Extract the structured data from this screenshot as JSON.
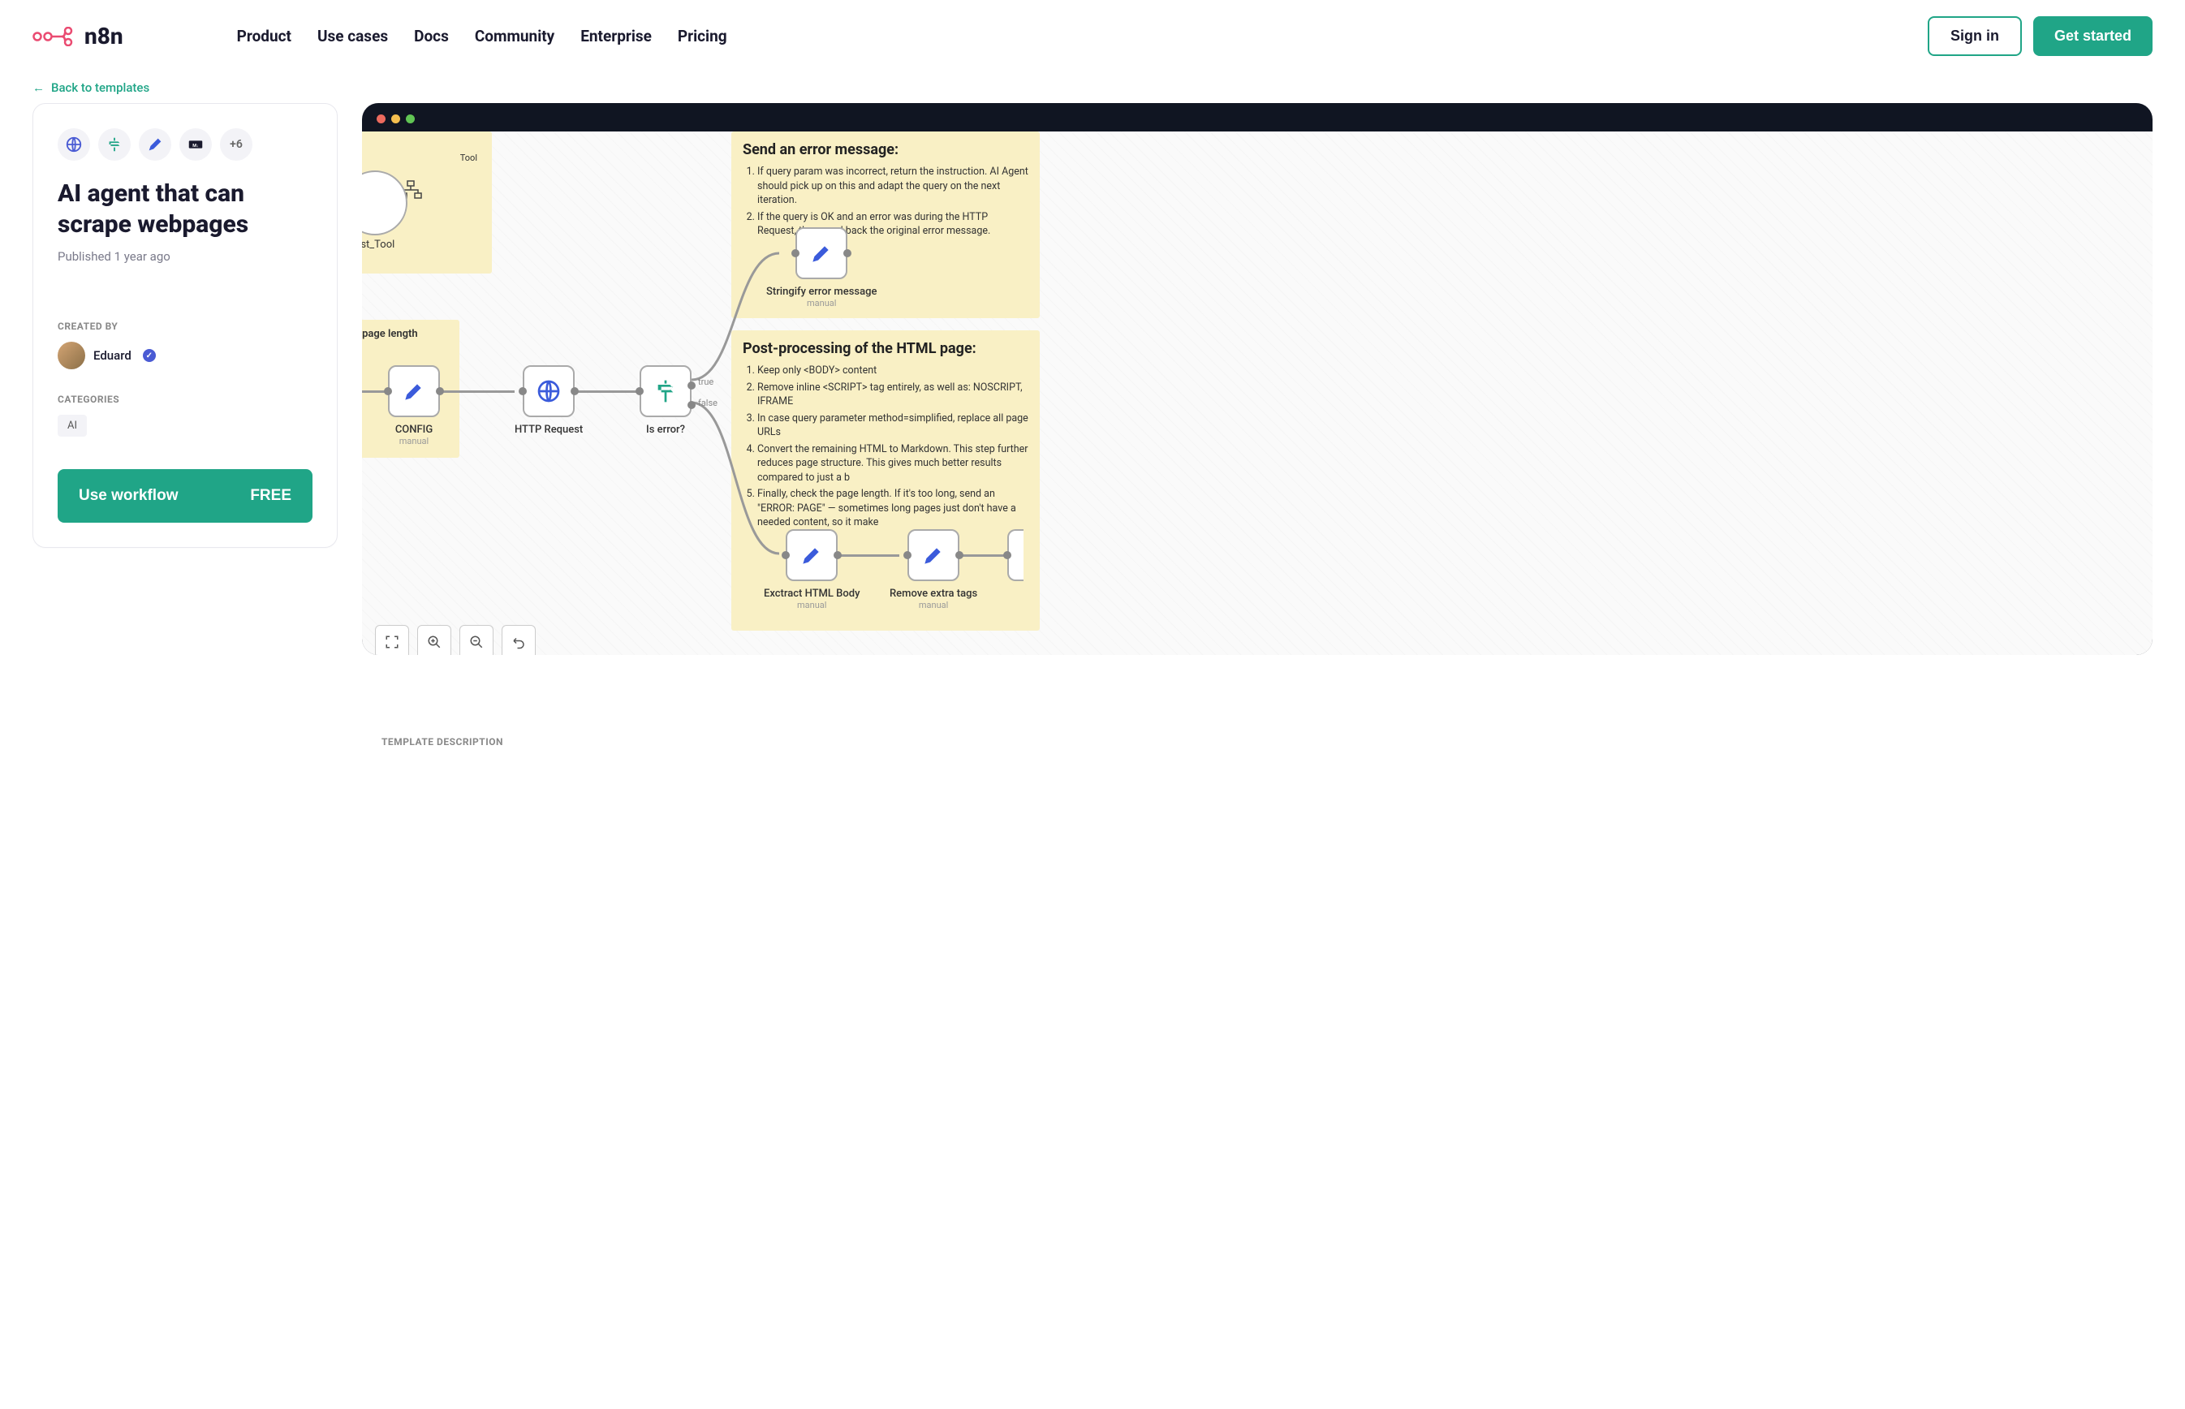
{
  "brand": "n8n",
  "nav": [
    "Product",
    "Use cases",
    "Docs",
    "Community",
    "Enterprise",
    "Pricing"
  ],
  "header": {
    "signin": "Sign in",
    "getstarted": "Get started"
  },
  "back_link": "Back to templates",
  "template": {
    "title": "AI agent that can scrape webpages",
    "published": "Published 1 year ago",
    "extra_icons": "+6",
    "created_by_label": "CREATED BY",
    "author": "Eduard",
    "categories_label": "CATEGORIES",
    "categories": [
      "AI"
    ],
    "use_label": "Use workflow",
    "price": "FREE"
  },
  "workflow": {
    "sticky_top_left": {
      "partial1": "Tool",
      "partial2": "equest_Tool",
      "partial3": "for a page length"
    },
    "sticky_error": {
      "title": "Send an error message:",
      "items": [
        "If query param was incorrect, return the instruction. AI Agent should pick up on this and adapt the query on the next iteration.",
        "If the query is OK and an error was during the HTTP Request, then send back the original error message."
      ]
    },
    "sticky_post": {
      "title": "Post-processing of the HTML page:",
      "items": [
        "Keep only <BODY> content",
        "Remove inline <SCRIPT> tag entirely, as well as: NOSCRIPT, IFRAME",
        "In case query parameter method=simplified, replace all page URLs",
        "Convert the remaining HTML to Markdown. This step further reduces page structure. This gives much better results compared to just a b",
        "Finally, check the page length. If it's too long, send an \"ERROR: PAGE\" — sometimes long pages just don't have a needed content, so it make"
      ]
    },
    "nodes": {
      "config": {
        "label": "CONFIG",
        "sub": "manual"
      },
      "http": {
        "label": "HTTP Request"
      },
      "iserror": {
        "label": "Is error?",
        "true": "true",
        "false": "false"
      },
      "stringify": {
        "label": "Stringify error message",
        "sub": "manual"
      },
      "extract": {
        "label": "Exctract HTML Body",
        "sub": "manual"
      },
      "removetags": {
        "label": "Remove extra tags",
        "sub": "manual"
      }
    },
    "controls": {
      "fit": "fit-view",
      "zoomin": "zoom-in",
      "zoomout": "zoom-out",
      "undo": "undo"
    }
  },
  "desc_label": "TEMPLATE DESCRIPTION"
}
